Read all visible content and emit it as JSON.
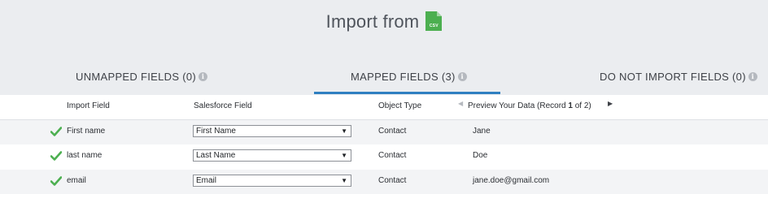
{
  "header": {
    "title": "Import from",
    "file_icon": "csv-file-icon",
    "file_icon_label": "CSV",
    "background": "#ebedf0",
    "icon_color": "#4caf50"
  },
  "tabs": [
    {
      "label": "UNMAPPED FIELDS (0)",
      "active": false,
      "icon": "info-icon"
    },
    {
      "label": "MAPPED FIELDS (3)",
      "active": true,
      "icon": "info-icon"
    },
    {
      "label": "DO NOT IMPORT FIELDS (0)",
      "active": false,
      "icon": "info-icon"
    }
  ],
  "accent_color": "#2f7fc1",
  "table": {
    "columns": {
      "import_field": "Import Field",
      "salesforce_field": "Salesforce Field",
      "object_type": "Object Type",
      "preview_prefix": "Preview Your Data (Record ",
      "preview_record": "1",
      "preview_suffix": " of 2)"
    },
    "rows": [
      {
        "status_icon": "check-icon",
        "import_field": "First name",
        "salesforce_field": "First Name",
        "object_type": "Contact",
        "preview": "Jane"
      },
      {
        "status_icon": "check-icon",
        "import_field": "last name",
        "salesforce_field": "Last Name",
        "object_type": "Contact",
        "preview": "Doe"
      },
      {
        "status_icon": "check-icon",
        "import_field": "email",
        "salesforce_field": "Email",
        "object_type": "Contact",
        "preview": "jane.doe@gmail.com"
      }
    ],
    "check_color": "#4caf50"
  }
}
